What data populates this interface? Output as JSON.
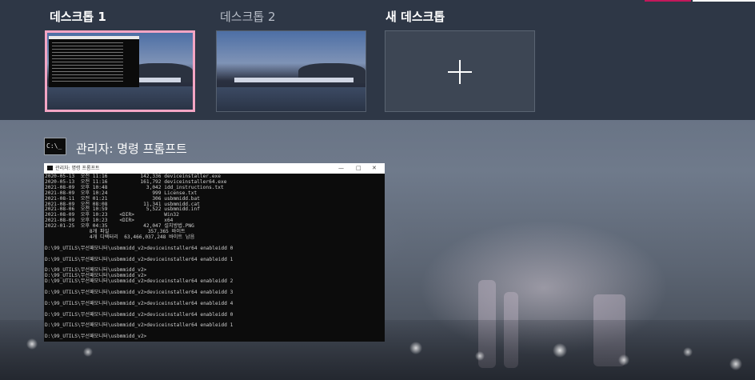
{
  "desktops": [
    {
      "label": "데스크톱 1",
      "active": true
    },
    {
      "label": "데스크톱 2",
      "active": false
    },
    {
      "label": "새 데스크톱"
    }
  ],
  "new_desktop_icon": "plus-icon",
  "window": {
    "icon": "command-prompt-icon",
    "icon_text": "C:\\_",
    "title": "관리자: 명령 프롬프트",
    "preview_titlebar": "관리자: 명령 프롬프트",
    "controls": [
      "—",
      "□",
      "✕"
    ],
    "console_lines": [
      "2020-05-13  오전 11:16           142,336 deviceinstaller.exe",
      "2020-05-13  오전 11:16           161,792 deviceinstaller64.exe",
      "2021-08-09  오후 10:48             3,042 idd_instructions.txt",
      "2021-08-09  오후 10:24               999 License.txt",
      "2021-08-11  오전 01:21               306 usbmmidd.bat",
      "2021-08-09  오전 08:08            11,341 usbmmidd.cat",
      "2021-08-06  오전 10:59             5,522 usbmmidd.inf",
      "2021-08-09  오후 10:23    <DIR>          Win32",
      "2021-08-09  오후 10:23    <DIR>          x64",
      "2022-01-25  오후 04:35            42,047 설치방법.PNG",
      "               8개 파일             357,365 바이트",
      "               4개 디렉터리  63,466,037,248 바이트 남음",
      "",
      "D:\\99_UTILS\\무선패모니터\\usbmmidd_v2>deviceinstaller64 enableidd 0",
      "",
      "D:\\99_UTILS\\무선패모니터\\usbmmidd_v2>deviceinstaller64 enableidd 1",
      "",
      "D:\\99_UTILS\\무선패모니터\\usbmmidd_v2>",
      "D:\\99_UTILS\\무선패모니터\\usbmmidd_v2>",
      "D:\\99_UTILS\\무선패모니터\\usbmmidd_v2>deviceinstaller64 enableidd 2",
      "",
      "D:\\99_UTILS\\무선패모니터\\usbmmidd_v2>deviceinstaller64 enableidd 3",
      "",
      "D:\\99_UTILS\\무선패모니터\\usbmmidd_v2>deviceinstaller64 enableidd 4",
      "",
      "D:\\99_UTILS\\무선패모니터\\usbmmidd_v2>deviceinstaller64 enableidd 0",
      "",
      "D:\\99_UTILS\\무선패모니터\\usbmmidd_v2>deviceinstaller64 enableidd 1",
      "",
      "D:\\99_UTILS\\무선패모니터\\usbmmidd_v2>"
    ]
  },
  "colors": {
    "strip_bg": "#2e3746",
    "active_border": "#f4a5c4",
    "active_label": "#ffffff",
    "inactive_label": "#b8bec8",
    "top_accent_pink": "#c2185b",
    "top_accent_white": "#ffffff"
  }
}
